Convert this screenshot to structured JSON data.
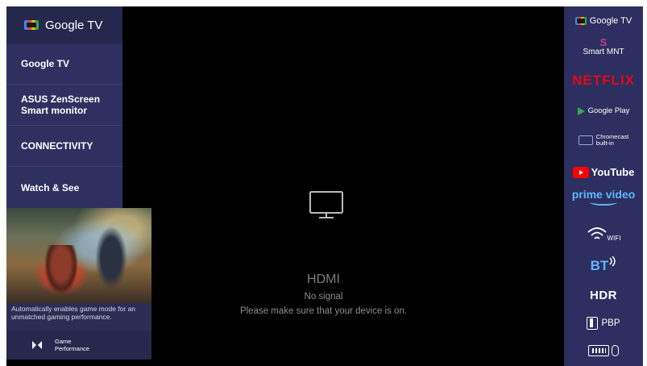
{
  "left_panel": {
    "header_label": "Google TV",
    "menu": [
      {
        "label": "Google TV"
      },
      {
        "label": "ASUS ZenScreen\nSmart monitor"
      },
      {
        "label": "CONNECTIVITY"
      },
      {
        "label": "Watch & See"
      }
    ],
    "game_card": {
      "description": "Automatically enables game mode for an unmatched gaming performance.",
      "footer_label_line1": "Game",
      "footer_label_line2": "Performance",
      "icon": "game-mode-icon"
    }
  },
  "center": {
    "icon": "monitor-icon",
    "source_title": "HDMI",
    "status": "No signal",
    "hint": "Please make sure that your device is on."
  },
  "right_bar": {
    "google_tv": "Google TV",
    "smart_mnt": "Smart MNT",
    "smart_logo": "S",
    "netflix": "NETFLIX",
    "google_play": "Google Play",
    "chromecast_line1": "Chromecast",
    "chromecast_line2": "built-in",
    "youtube": "YouTube",
    "prime_video": "prime video",
    "wifi": "WIFI",
    "bt": "BT",
    "hdr": "HDR",
    "pbp": "PBP",
    "keyboard_mouse_icon": "keyboard-mouse-icon"
  },
  "colors": {
    "panel_bg": "#2e3160",
    "header_bg": "#25284d",
    "sidebar_bg": "#2c2f5f",
    "netflix_red": "#e50914",
    "accent_blue": "#5fb7ff"
  }
}
